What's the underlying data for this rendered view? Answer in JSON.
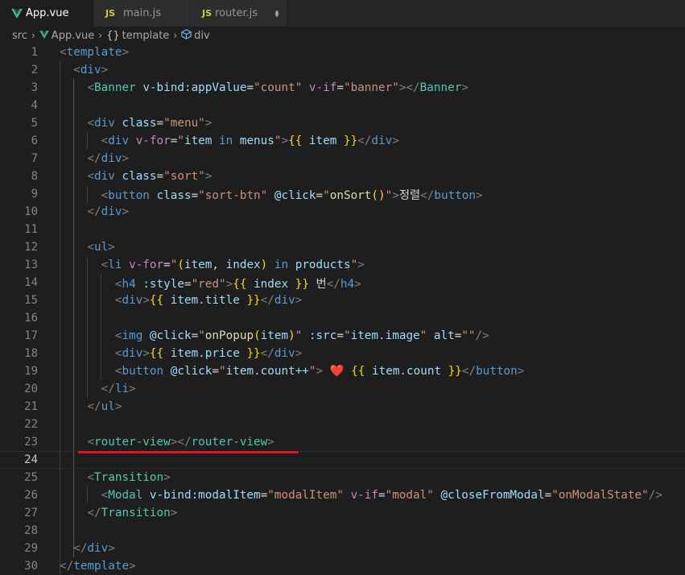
{
  "tabs": [
    {
      "label": "App.vue",
      "icon": "vue-icon",
      "active": true,
      "modified": true
    },
    {
      "label": "main.js",
      "icon": "js-icon",
      "active": false,
      "modified": false
    },
    {
      "label": "router.js",
      "icon": "js-icon",
      "active": false,
      "modified": true
    }
  ],
  "breadcrumb": {
    "items": [
      "src",
      "App.vue",
      "template",
      "div"
    ],
    "template_icon_text": "{}"
  },
  "js_badge": "JS",
  "colors": {
    "background": "#1e1e1e",
    "tab_bar": "#252526",
    "vue_green": "#41b883",
    "annotation_red": "#e81123"
  },
  "current_line": 24,
  "lines": [
    {
      "n": "1"
    },
    {
      "n": "2"
    },
    {
      "n": "3"
    },
    {
      "n": "4"
    },
    {
      "n": "5"
    },
    {
      "n": "6"
    },
    {
      "n": "7"
    },
    {
      "n": "8"
    },
    {
      "n": "9"
    },
    {
      "n": "10"
    },
    {
      "n": "11"
    },
    {
      "n": "12"
    },
    {
      "n": "13"
    },
    {
      "n": "14"
    },
    {
      "n": "15"
    },
    {
      "n": "16"
    },
    {
      "n": "17"
    },
    {
      "n": "18"
    },
    {
      "n": "19"
    },
    {
      "n": "20"
    },
    {
      "n": "21"
    },
    {
      "n": "22"
    },
    {
      "n": "23"
    },
    {
      "n": "24"
    },
    {
      "n": "25"
    },
    {
      "n": "26"
    },
    {
      "n": "27"
    },
    {
      "n": "28"
    },
    {
      "n": "29"
    },
    {
      "n": "30"
    }
  ],
  "code": {
    "l1": {
      "lt": "<",
      "tag": "template",
      "gt": ">"
    },
    "l2": {
      "lt": "<",
      "tag": "div",
      "gt": ">"
    },
    "l3": {
      "lt": "<",
      "tag": "Banner",
      "a1": "v-bind:appValue",
      "eq": "=",
      "v1": "\"count\"",
      "d1": "v-if",
      "v2": "\"banner\"",
      "gt": ">",
      "close_lt": "</",
      "close_tag": "Banner",
      "close_gt": ">"
    },
    "l5": {
      "lt": "<",
      "tag": "div",
      "a1": "class",
      "eq": "=",
      "v1": "\"menu\"",
      "gt": ">"
    },
    "l6": {
      "lt": "<",
      "tag": "div",
      "d1": "v-for",
      "eq": "=",
      "q1": "\"",
      "var1": "item",
      "kw": "in",
      "var2": "menus",
      "q2": "\"",
      "gt": ">",
      "m1": "{{",
      "mv": "item",
      "m2": "}}",
      "close_lt": "</",
      "close_tag": "div",
      "close_gt": ">"
    },
    "l7": {
      "lt": "</",
      "tag": "div",
      "gt": ">"
    },
    "l8": {
      "lt": "<",
      "tag": "div",
      "a1": "class",
      "eq": "=",
      "v1": "\"sort\"",
      "gt": ">"
    },
    "l9": {
      "lt": "<",
      "tag": "button",
      "a1": "class",
      "eq": "=",
      "v1": "\"sort-btn\"",
      "a2": "@click",
      "q1": "\"",
      "fn": "onSort",
      "parens": "()",
      "q2": "\"",
      "gt": ">",
      "text": "정렬",
      "close_lt": "</",
      "close_tag": "button",
      "close_gt": ">"
    },
    "l10": {
      "lt": "</",
      "tag": "div",
      "gt": ">"
    },
    "l12": {
      "lt": "<",
      "tag": "ul",
      "gt": ">"
    },
    "l13": {
      "lt": "<",
      "tag": "li",
      "d1": "v-for",
      "eq": "=",
      "q1": "\"",
      "p1": "(",
      "var1": "item",
      "comma": ", ",
      "var2": "index",
      "p2": ")",
      "kw": "in",
      "var3": "products",
      "q2": "\"",
      "gt": ">"
    },
    "l14": {
      "lt": "<",
      "tag": "h4",
      "a1": ":style",
      "eq": "=",
      "v1": "\"red\"",
      "gt": ">",
      "m1": "{{",
      "mv": "index",
      "m2": "}}",
      "text": "번",
      "close_lt": "</",
      "close_tag": "h4",
      "close_gt": ">"
    },
    "l15": {
      "lt": "<",
      "tag": "div",
      "gt": ">",
      "m1": "{{",
      "mv": "item.title",
      "m2": "}}",
      "close_lt": "</",
      "close_tag": "div",
      "close_gt": ">"
    },
    "l17": {
      "lt": "<",
      "tag": "img",
      "a1": "@click",
      "q1": "\"",
      "fn": "onPopup",
      "p1": "(",
      "var1": "item",
      "p2": ")",
      "q2": "\"",
      "a2": ":src",
      "q3": "\"",
      "var2": "item.image",
      "q4": "\"",
      "a3": "alt",
      "v3": "\"\"",
      "gt": "/>"
    },
    "l18": {
      "lt": "<",
      "tag": "div",
      "gt": ">",
      "m1": "{{",
      "mv": "item.price",
      "m2": "}}",
      "close_lt": "</",
      "close_tag": "div",
      "close_gt": ">"
    },
    "l19": {
      "lt": "<",
      "tag": "button",
      "a1": "@click",
      "q1": "\"",
      "var1": "item.count++",
      "q2": "\"",
      "gt": ">",
      "heart": "❤️",
      "m1": "{{",
      "mv": "item.count",
      "m2": "}}",
      "close_lt": "</",
      "close_tag": "button",
      "close_gt": ">"
    },
    "l20": {
      "lt": "</",
      "tag": "li",
      "gt": ">"
    },
    "l21": {
      "lt": "</",
      "tag": "ul",
      "gt": ">"
    },
    "l23": {
      "lt": "<",
      "tag": "router-view",
      "gt": ">",
      "close_lt": "</",
      "close_tag": "router-view",
      "close_gt": ">"
    },
    "l25": {
      "lt": "<",
      "tag": "Transition",
      "gt": ">"
    },
    "l26": {
      "lt": "<",
      "tag": "Modal",
      "a1": "v-bind:modalItem",
      "eq": "=",
      "v1": "\"modalItem\"",
      "d1": "v-if",
      "v2": "\"modal\"",
      "a2": "@closeFromModal",
      "v3": "\"onModalState\"",
      "gt": "/>"
    },
    "l27": {
      "lt": "</",
      "tag": "Transition",
      "gt": ">"
    },
    "l29": {
      "lt": "</",
      "tag": "div",
      "gt": ">"
    },
    "l30": {
      "lt": "</",
      "tag": "template",
      "gt": ">"
    }
  }
}
